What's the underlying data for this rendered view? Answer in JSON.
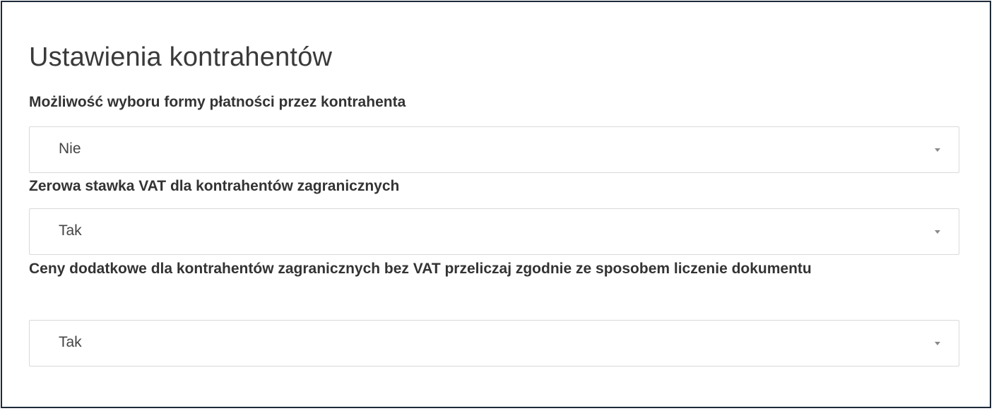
{
  "panel": {
    "title": "Ustawienia kontrahentów"
  },
  "settings": [
    {
      "label": "Możliwość wyboru formy płatności przez kontrahenta",
      "value": "Nie"
    },
    {
      "label": "Zerowa stawka VAT dla kontrahentów zagranicznych",
      "value": "Tak"
    },
    {
      "label": "Ceny dodatkowe dla kontrahentów zagranicznych bez VAT przeliczaj zgodnie ze sposobem liczenie dokumentu",
      "value": "Tak"
    }
  ],
  "icons": {
    "dropdown": "chevron-down-icon"
  }
}
